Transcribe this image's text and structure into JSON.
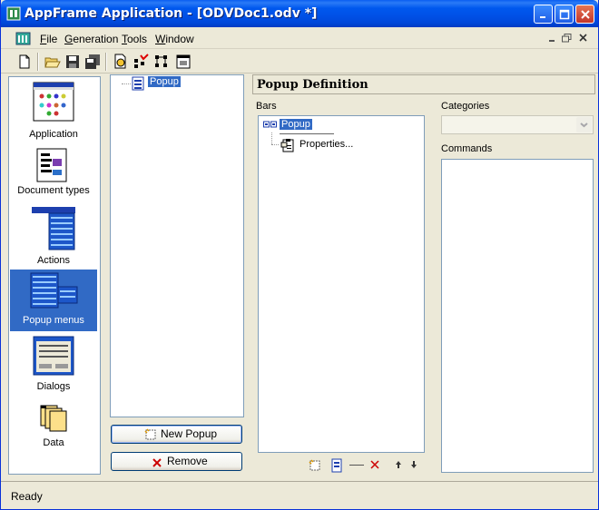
{
  "window": {
    "title": "AppFrame Application - [ODVDoc1.odv *]"
  },
  "menubar": {
    "items": [
      {
        "label": "File",
        "accel": "F",
        "rest": "ile"
      },
      {
        "label": "Generation",
        "accel": "G",
        "rest": "eneration"
      },
      {
        "label": "Tools",
        "accel": "T",
        "rest": "ools"
      },
      {
        "label": "Window",
        "accel": "W",
        "rest": "indow"
      }
    ]
  },
  "toolbar": {
    "icons": [
      "new-document-icon",
      "open-folder-icon",
      "save-icon",
      "save-all-icon",
      "generate-icon",
      "check-icon",
      "validate-icon",
      "preview-icon"
    ]
  },
  "nav": {
    "items": [
      {
        "label": "Application",
        "icon": "application-icon",
        "selected": false
      },
      {
        "label": "Document types",
        "icon": "document-types-icon",
        "selected": false
      },
      {
        "label": "Actions",
        "icon": "actions-icon",
        "selected": false
      },
      {
        "label": "Popup menus",
        "icon": "popup-menus-icon",
        "selected": true
      },
      {
        "label": "Dialogs",
        "icon": "dialogs-icon",
        "selected": false
      },
      {
        "label": "Data",
        "icon": "data-icon",
        "selected": false
      }
    ]
  },
  "tree": {
    "root_label": "Popup"
  },
  "buttons": {
    "new_popup": {
      "label": "New Popup",
      "accel": "P"
    },
    "remove": {
      "label": "Remove"
    }
  },
  "definition": {
    "header": "Popup Definition",
    "bars_label": "Bars",
    "bar_root": "Popup",
    "bar_child": "Properties...",
    "categories_label": "Categories",
    "categories_value": "",
    "commands_label": "Commands"
  },
  "status": {
    "text": "Ready"
  },
  "colors": {
    "title_bar": "#0054E3",
    "selection": "#316AC5",
    "face": "#ECE9D8"
  }
}
